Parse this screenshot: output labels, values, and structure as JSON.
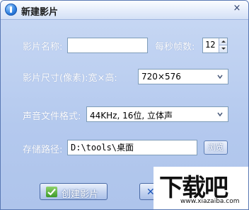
{
  "window": {
    "title": "新建影片",
    "close_glyph": "×"
  },
  "form": {
    "name_label": "影片名称:",
    "name_value": "",
    "fps_label": "每秒帧数:",
    "fps_value": "12",
    "size_label": "影片尺寸(像素):宽×高:",
    "size_value": "720×576",
    "audio_label": "声音文件格式:",
    "audio_value": "44KHz, 16位, 立体声",
    "path_label": "存储路径:",
    "path_value": "D:\\tools\\桌面",
    "browse_label": "浏览"
  },
  "buttons": {
    "create_label": "创建影片",
    "cancel_glyph": "✕"
  },
  "watermark": {
    "text": "下载吧",
    "url": "www.xiazaiba.com"
  },
  "icons": [
    "info-icon",
    "close-icon",
    "spin-up-icon",
    "spin-down-icon",
    "chevron-down-icon",
    "checkmark-icon",
    "cancel-icon"
  ]
}
